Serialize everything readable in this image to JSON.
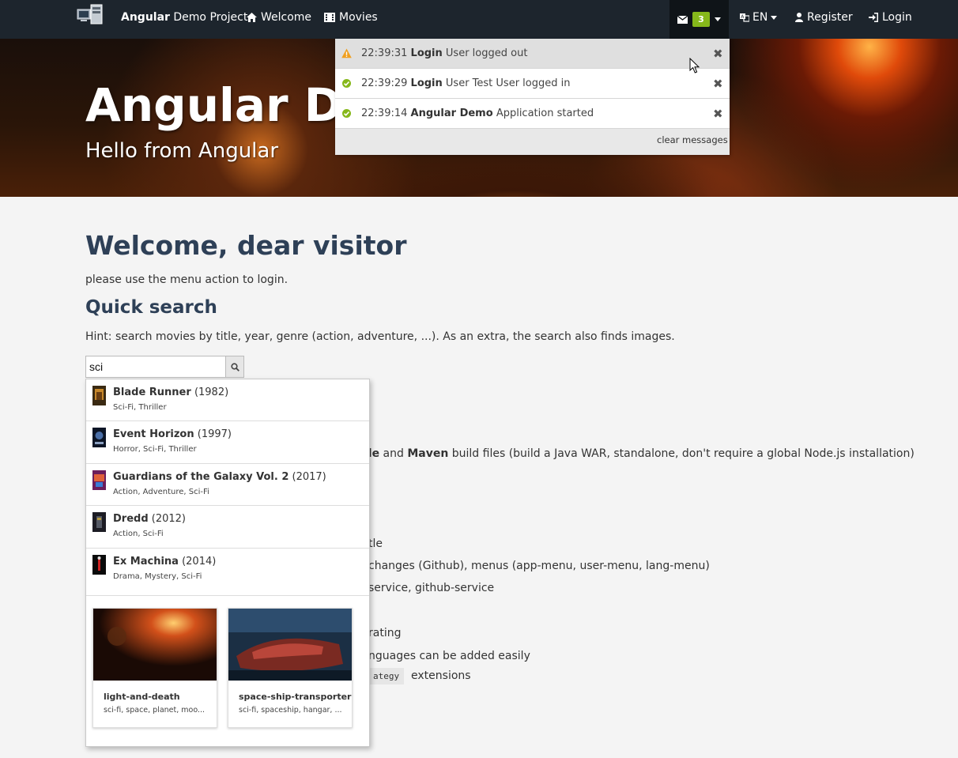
{
  "navbar": {
    "brand_bold": "Angular",
    "brand_rest": " Demo Project",
    "welcome": "Welcome",
    "movies": "Movies",
    "message_count": "3",
    "language": "EN",
    "register": "Register",
    "login": "Login"
  },
  "hero": {
    "title": "Angular Demo",
    "subtitle": "Hello from Angular"
  },
  "main": {
    "welcome_heading": "Welcome, dear visitor",
    "login_hint": "please use the menu action to login.",
    "quick_search_heading": "Quick search",
    "search_hint": "Hint: search movies by title, year, genre (action, adventure, ...). As an extra, the search also finds images.",
    "search_value": "sci"
  },
  "background_text": {
    "line1_a": "lle",
    "line1_b": " and ",
    "line1_c": "Maven",
    "line1_d": " build files (build a Java WAR, standalone, don't require a global Node.js installation)",
    "line2": "tle",
    "line3": "changes (Github), menus (app-menu, user-menu, lang-menu)",
    "line4": "service, github-service",
    "line5": "rating",
    "line6": "nguages can be added easily",
    "line7_code": "ategy",
    "line7_text": "extensions"
  },
  "search_results": [
    {
      "title": "Blade Runner",
      "year": "(1982)",
      "genres": "Sci-Fi, Thriller"
    },
    {
      "title": "Event Horizon",
      "year": "(1997)",
      "genres": "Horror, Sci-Fi, Thriller"
    },
    {
      "title": "Guardians of the Galaxy Vol. 2",
      "year": "(2017)",
      "genres": "Action, Adventure, Sci-Fi"
    },
    {
      "title": "Dredd",
      "year": "(2012)",
      "genres": "Action, Sci-Fi"
    },
    {
      "title": "Ex Machina",
      "year": "(2014)",
      "genres": "Drama, Mystery, Sci-Fi"
    }
  ],
  "image_results": [
    {
      "name": "light-and-death",
      "tags": "sci-fi, space, planet, moo..."
    },
    {
      "name": "space-ship-transporter",
      "tags": "sci-fi, spaceship, hangar, ..."
    }
  ],
  "messages": [
    {
      "time": "22:39:31",
      "source": "Login",
      "text": "User logged out",
      "level": "warning"
    },
    {
      "time": "22:39:29",
      "source": "Login",
      "text": "User Test User logged in",
      "level": "success"
    },
    {
      "time": "22:39:14",
      "source": "Angular Demo",
      "text": "Application started",
      "level": "success"
    }
  ],
  "clear_messages": "clear messages",
  "colors": {
    "navbar": "#1d252d",
    "badge": "#86b81b",
    "heading": "#2e4057",
    "warning": "#f0a020",
    "success": "#86b81b"
  }
}
